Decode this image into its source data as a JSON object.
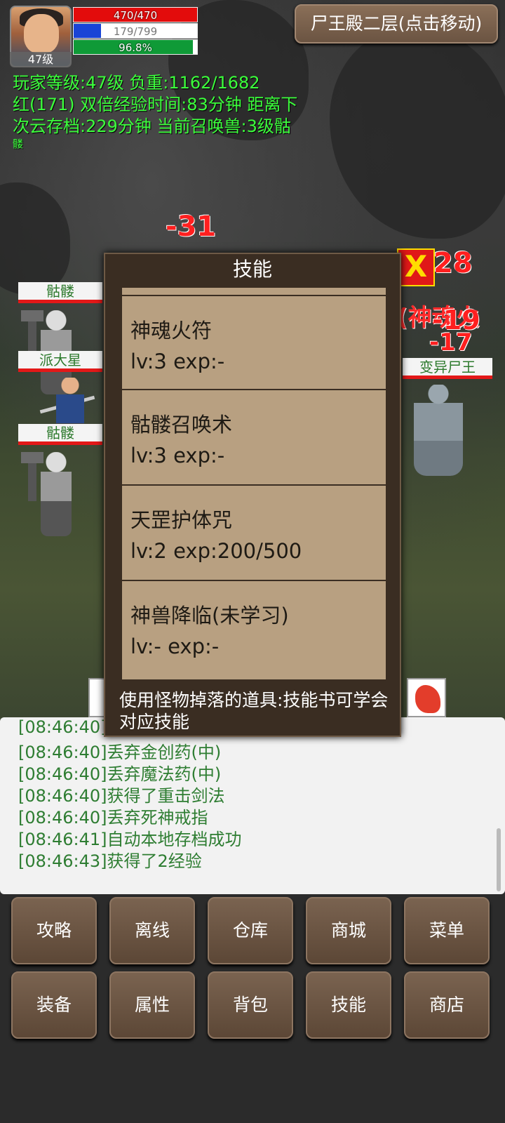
{
  "hud": {
    "player_level_badge": "47级",
    "hp_text": "470/470",
    "hp_fraction": 1.0,
    "mp_text": "179/799",
    "mp_fraction": 0.224,
    "exp_text": "96.8%",
    "exp_fraction": 0.968,
    "location_button": "尸王殿二层(点击移动)"
  },
  "info_lines": [
    "玩家等级:47级 负重:1162/1682",
    "红(171) 双倍经验时间:83分钟 距离下",
    "次云存档:229分钟 当前召唤兽:3级骷",
    "髅"
  ],
  "battle": {
    "allies": [
      {
        "name": "骷髅"
      },
      {
        "name": "派大星"
      },
      {
        "name": "骷髅"
      }
    ],
    "enemy": {
      "name": "变异尸王"
    },
    "damage": [
      "-31",
      "28",
      "-19",
      "-17"
    ],
    "skill_cast_text": "(神魂火",
    "enemy_marker": "X"
  },
  "skill_dialog": {
    "title": "技能",
    "skills": [
      {
        "name": "神魂火符",
        "meta": "lv:3   exp:-"
      },
      {
        "name": "骷髅召唤术",
        "meta": "lv:3   exp:-"
      },
      {
        "name": "天罡护体咒",
        "meta": "lv:2   exp:200/500"
      },
      {
        "name": "神兽降临(未学习)",
        "meta": "lv:-   exp:-"
      }
    ],
    "hint": "使用怪物掉落的道具:技能书可学会对应技能"
  },
  "log": [
    "[08:46:40]",
    "[08:46:40]丢弃金创药(中)",
    "[08:46:40]丢弃魔法药(中)",
    "[08:46:40]获得了重击剑法",
    "[08:46:40]丢弃死神戒指",
    "[08:46:41]自动本地存档成功",
    "[08:46:43]获得了2经验"
  ],
  "buttons_row1": [
    "攻略",
    "离线",
    "仓库",
    "商城",
    "菜单"
  ],
  "buttons_row2": [
    "装备",
    "属性",
    "背包",
    "技能",
    "商店"
  ]
}
